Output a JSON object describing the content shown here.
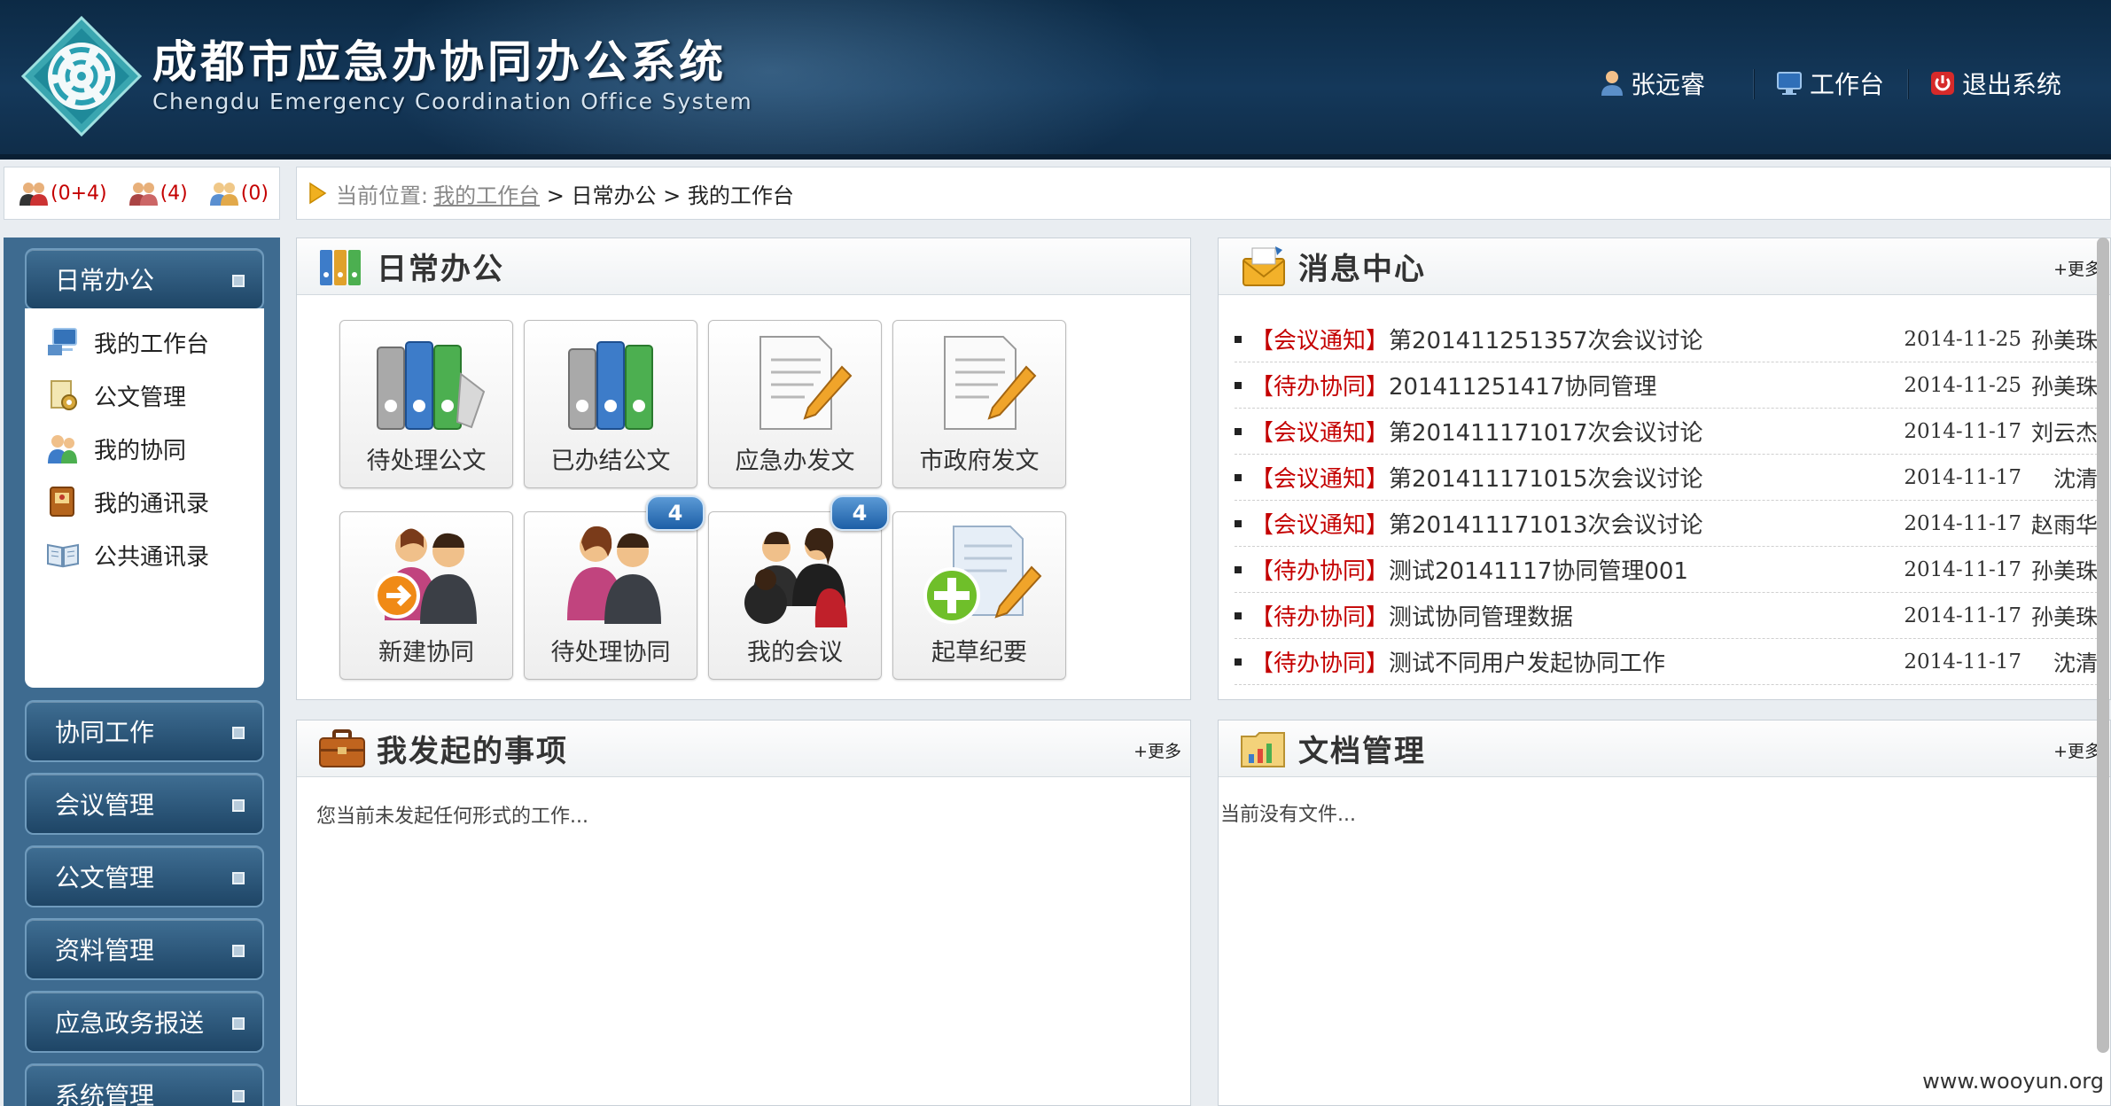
{
  "header": {
    "title_cn": "成都市应急办协同办公系统",
    "title_en": "Chengdu Emergency Coordination Office System",
    "user": "张远睿",
    "workbench": "工作台",
    "logout": "退出系统"
  },
  "counts": [
    {
      "icon": "users-online-icon",
      "text": "(0+4)"
    },
    {
      "icon": "users-group-icon",
      "text": "(4)"
    },
    {
      "icon": "users-idle-icon",
      "text": "(0)"
    }
  ],
  "breadcrumb": {
    "prefix": "当前位置:",
    "home": "我的工作台",
    "path": " > 日常办公 > 我的工作台"
  },
  "sidebar": {
    "active": "日常办公",
    "sub_items": [
      "我的工作台",
      "公文管理",
      "我的协同",
      "我的通讯录",
      "公共通讯录"
    ],
    "menus": [
      "协同工作",
      "会议管理",
      "公文管理",
      "资料管理",
      "应急政务报送",
      "系统管理"
    ]
  },
  "daily": {
    "title": "日常办公",
    "tiles": [
      {
        "label": "待处理公文",
        "icon": "binders-icon",
        "badge": ""
      },
      {
        "label": "已办结公文",
        "icon": "binders-done-icon",
        "badge": ""
      },
      {
        "label": "应急办发文",
        "icon": "document-pen-icon",
        "badge": ""
      },
      {
        "label": "市政府发文",
        "icon": "document-pen-icon",
        "badge": ""
      },
      {
        "label": "新建协同",
        "icon": "people-arrow-icon",
        "badge": ""
      },
      {
        "label": "待处理协同",
        "icon": "people-icon",
        "badge": "4"
      },
      {
        "label": "我的会议",
        "icon": "meeting-icon",
        "badge": "4"
      },
      {
        "label": "起草纪要",
        "icon": "draft-add-icon",
        "badge": ""
      }
    ]
  },
  "messages": {
    "title": "消息中心",
    "more": "+更多",
    "items": [
      {
        "tag": "【会议通知】",
        "subject": "第201411251357次会议讨论",
        "date": "2014-11-25",
        "who": "孙美珠"
      },
      {
        "tag": "【待办协同】",
        "subject": "201411251417协同管理",
        "date": "2014-11-25",
        "who": "孙美珠"
      },
      {
        "tag": "【会议通知】",
        "subject": "第201411171017次会议讨论",
        "date": "2014-11-17",
        "who": "刘云杰"
      },
      {
        "tag": "【会议通知】",
        "subject": "第201411171015次会议讨论",
        "date": "2014-11-17",
        "who": "沈清"
      },
      {
        "tag": "【会议通知】",
        "subject": "第201411171013次会议讨论",
        "date": "2014-11-17",
        "who": "赵雨华"
      },
      {
        "tag": "【待办协同】",
        "subject": "测试20141117协同管理001",
        "date": "2014-11-17",
        "who": "孙美珠"
      },
      {
        "tag": "【待办协同】",
        "subject": "测试协同管理数据",
        "date": "2014-11-17",
        "who": "孙美珠"
      },
      {
        "tag": "【待办协同】",
        "subject": "测试不同用户发起协同工作",
        "date": "2014-11-17",
        "who": "沈清"
      }
    ]
  },
  "initiated": {
    "title": "我发起的事项",
    "more": "+更多",
    "empty": "您当前未发起任何形式的工作..."
  },
  "documents": {
    "title": "文档管理",
    "more": "+更多",
    "empty": "当前没有文件..."
  },
  "watermark": "www.wooyun.org"
}
